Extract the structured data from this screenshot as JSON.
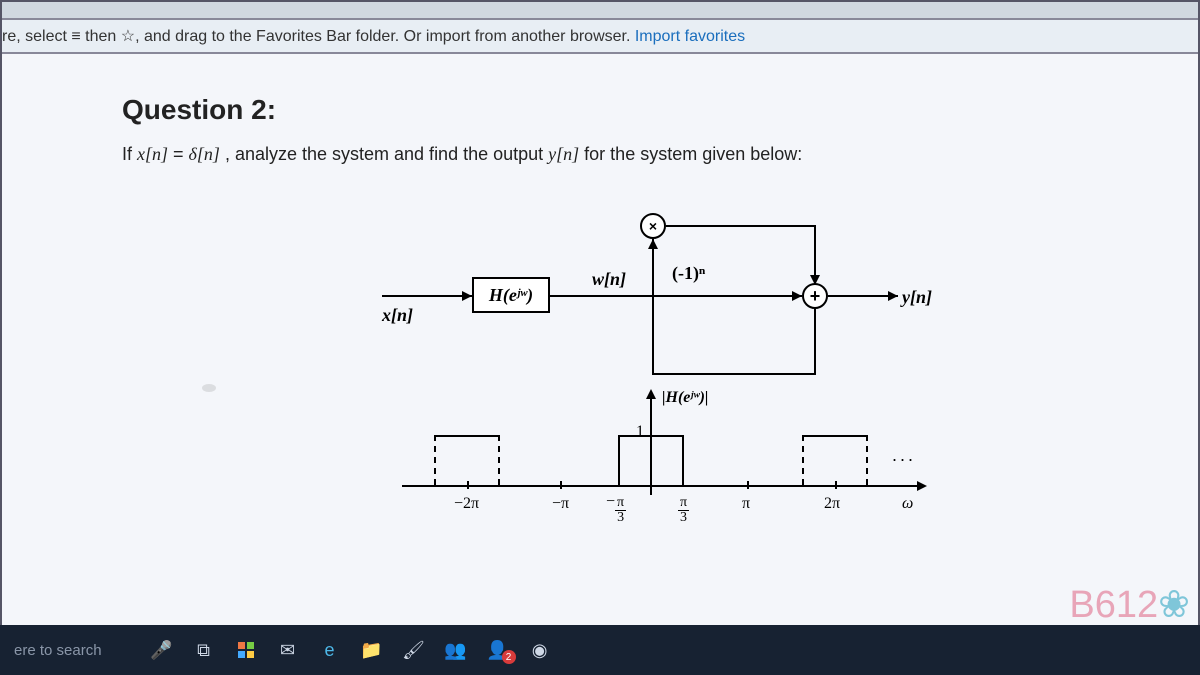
{
  "favorites_bar": {
    "prefix": "re, select ≡ then ☆, and drag to the Favorites Bar folder. Or import from another browser. ",
    "link": "Import favorites"
  },
  "question": {
    "title": "Question 2:",
    "body_prefix": "If ",
    "body_eq_lhs": "x[n]",
    "body_eq_mid": " = ",
    "body_eq_rhs": "δ[n]",
    "body_suffix": ", analyze the system and find the output ",
    "body_out": "y[n]",
    "body_tail": " for the system given below:"
  },
  "diagram": {
    "x_label": "x[n]",
    "h_box": "H(eʲʷ)",
    "w_label": "w[n]",
    "neg1_label": "(-1)ⁿ",
    "mult_symbol": "×",
    "plus_symbol": "+",
    "y_label": "y[n]"
  },
  "plot": {
    "y_axis_label": "|H(eʲʷ)|",
    "one_label": "1",
    "ticks": {
      "m2pi": "−2π",
      "mpi": "−π",
      "mpi3_num": "π",
      "mpi3_den": "3",
      "pi3_num": "π",
      "pi3_den": "3",
      "pi": "π",
      "p2pi": "2π",
      "omega": "ω"
    },
    "ellipsis": "..."
  },
  "watermark": "B612",
  "taskbar": {
    "search": "ere to search",
    "badge_count": "2"
  }
}
